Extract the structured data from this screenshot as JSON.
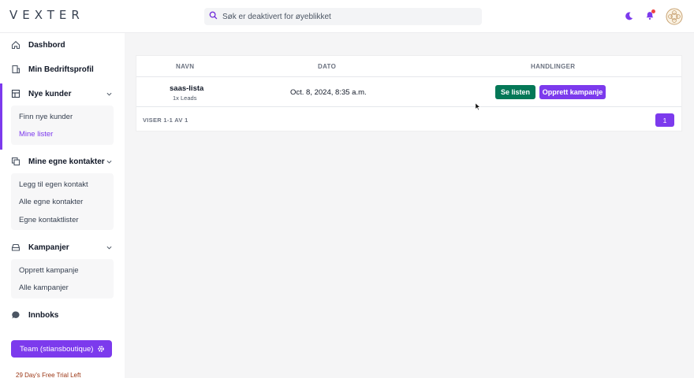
{
  "app": {
    "logo": "VEXTER"
  },
  "search": {
    "placeholder": "Søk er deaktivert for øyeblikket"
  },
  "header": {
    "icons": [
      "moon-icon",
      "bell-icon",
      "avatar"
    ]
  },
  "sidebar": {
    "items": [
      {
        "label": "Dashbord",
        "icon": "home-icon"
      },
      {
        "label": "Min Bedriftsprofil",
        "icon": "building-icon"
      },
      {
        "label": "Nye kunder",
        "icon": "grid-icon",
        "subitems": [
          "Finn nye kunder",
          "Mine lister"
        ],
        "active_sub": "Mine lister"
      },
      {
        "label": "Mine egne kontakter",
        "icon": "copy-icon",
        "subitems": [
          "Legg til egen kontakt",
          "Alle egne kontakter",
          "Egne kontaktlister"
        ]
      },
      {
        "label": "Kampanjer",
        "icon": "inbox-tray-icon",
        "subitems": [
          "Opprett kampanje",
          "Alle kampanjer"
        ]
      },
      {
        "label": "Innboks",
        "icon": "chat-icon"
      }
    ],
    "team_button": "Team (stiansboutique)",
    "trial_text": "29 Day's Free Trial Left"
  },
  "table": {
    "columns": [
      "NAVN",
      "DATO",
      "HANDLINGER"
    ],
    "rows": [
      {
        "name": "saas-lista",
        "leads": "1x Leads",
        "date": "Oct. 8, 2024, 8:35 a.m.",
        "actions": [
          "Se listen",
          "Opprett kampanje"
        ]
      }
    ],
    "footer": "VISER 1-1 AV 1",
    "page": "1"
  },
  "colors": {
    "accent": "#7c3aed",
    "success": "#047857",
    "trial": "#9a3412"
  }
}
